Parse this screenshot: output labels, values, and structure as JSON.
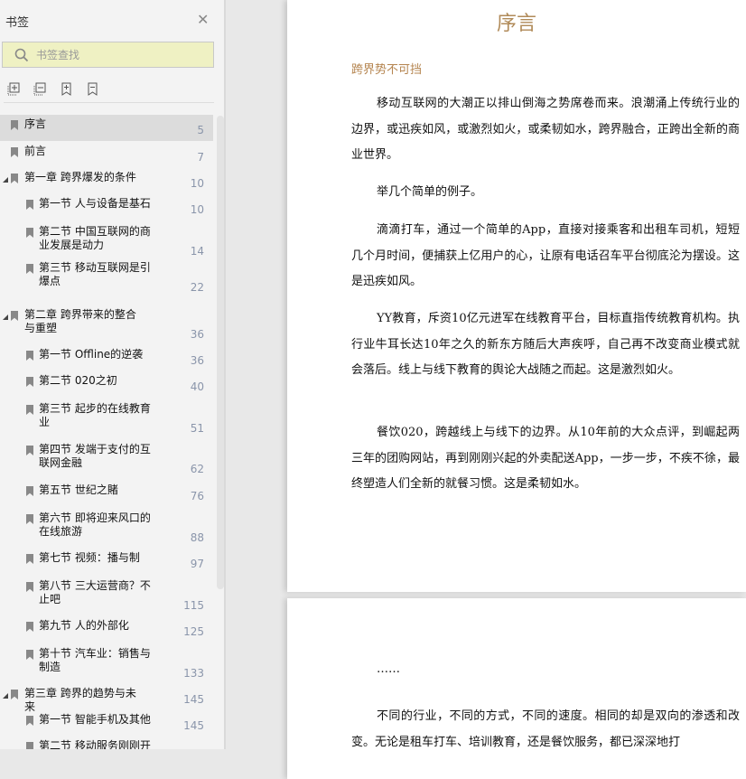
{
  "sidebar": {
    "title": "书签",
    "search_placeholder": "书签查找",
    "tools": [
      "expand-all",
      "collapse-all",
      "add-bookmark",
      "remove-bookmark"
    ],
    "items": [
      {
        "label": "序言",
        "page": "5",
        "level": 0,
        "selected": true
      },
      {
        "label": "前言",
        "page": "7",
        "level": 0
      },
      {
        "label": "第一章 跨界爆发的条件",
        "page": "10",
        "level": 0,
        "expanded": true
      },
      {
        "label": "第一节 人与设备是基石",
        "page": "10",
        "level": 1
      },
      {
        "label": "第二节 中国互联网的商业发展是动力",
        "page": "14",
        "level": 1
      },
      {
        "label": "第三节 移动互联网是引爆点",
        "page": "22",
        "level": 1
      },
      {
        "label": "第二章 跨界带来的整合与重塑",
        "page": "36",
        "level": 0,
        "expanded": true
      },
      {
        "label": "第一节 Offline的逆袭",
        "page": "36",
        "level": 1
      },
      {
        "label": "第二节 020之初",
        "page": "40",
        "level": 1
      },
      {
        "label": "第三节 起步的在线教育业",
        "page": "51",
        "level": 1
      },
      {
        "label": "第四节 发端于支付的互联网金融",
        "page": "62",
        "level": 1
      },
      {
        "label": "第五节 世纪之賭",
        "page": "76",
        "level": 1
      },
      {
        "label": "第六节 即将迎来风口的在线旅游",
        "page": "88",
        "level": 1
      },
      {
        "label": "第七节 视频：播与制",
        "page": "97",
        "level": 1
      },
      {
        "label": "第八节 三大运营商？不止吧",
        "page": "115",
        "level": 1
      },
      {
        "label": "第九节 人的外部化",
        "page": "125",
        "level": 1
      },
      {
        "label": "第十节 汽车业：销售与制造",
        "page": "133",
        "level": 1
      },
      {
        "label": "第三章 跨界的趋势与未来",
        "page": "145",
        "level": 0,
        "expanded": true
      },
      {
        "label": "第一节 智能手机及其他",
        "page": "145",
        "level": 1
      },
      {
        "label": "第二节 移动服务刚刚开",
        "page": "",
        "level": 1
      }
    ]
  },
  "document": {
    "title": "序言",
    "subtitle": "跨界势不可挡",
    "paragraphs": [
      "移动互联网的大潮正以排山倒海之势席卷而来。浪潮涌上传统行业的边界，或迅疾如风，或激烈如火，或柔韧如水，跨界融合，正跨出全新的商业世界。",
      "举几个简单的例子。",
      "滴滴打车，通过一个简单的App，直接对接乘客和出租车司机，短短几个月时间，便捕获上亿用户的心，让原有电话召车平台彻底沦为摆设。这是迅疾如风。",
      "YY教育，斥资10亿元进军在线教育平台，目标直指传统教育机构。执行业牛耳长达10年之久的新东方随后大声疾呼，自己再不改变商业模式就会落后。线上与线下教育的舆论大战随之而起。这是激烈如火。",
      "餐饮020，跨越线上与线下的边界。从10年前的大众点评，到崛起两三年的团购网站，再到刚刚兴起的外卖配送App，一步一步，不疾不徐，最终塑造人们全新的就餐习惯。这是柔韧如水。"
    ],
    "page2": [
      "……",
      "不同的行业，不同的方式，不同的速度。相同的却是双向的渗透和改变。无论是租车打车、培训教育，还是餐饮服务，都已深深地打"
    ]
  }
}
